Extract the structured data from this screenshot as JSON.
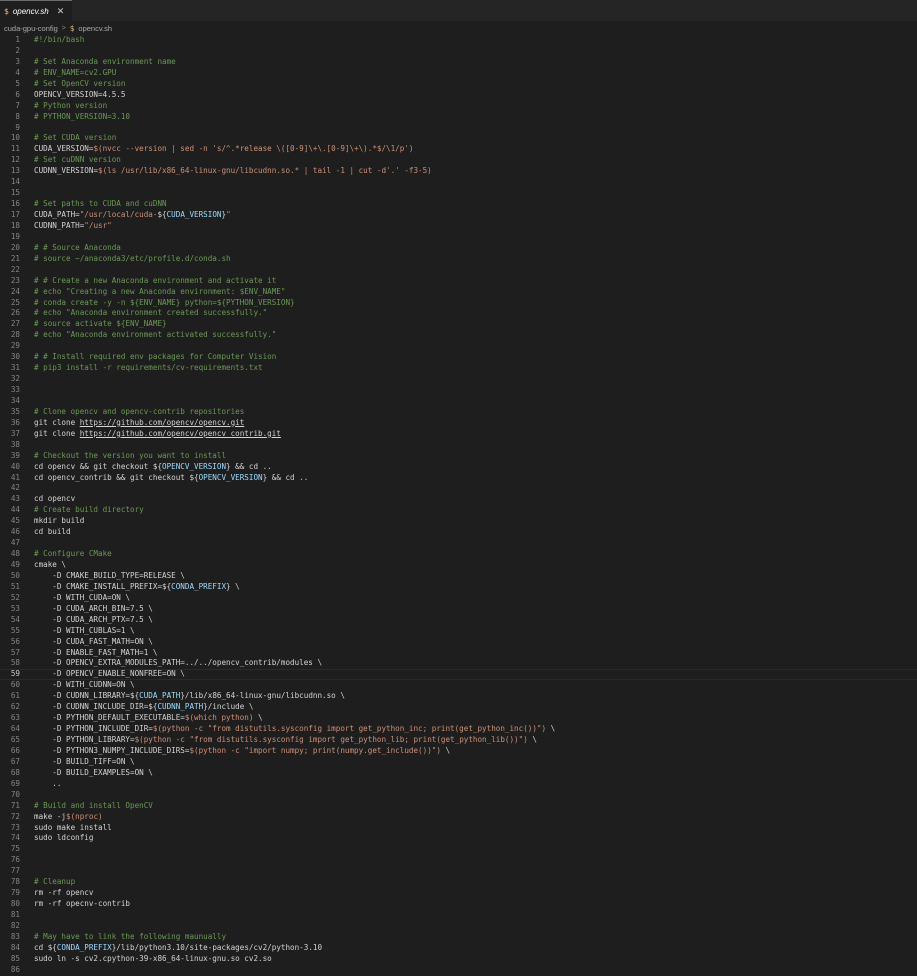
{
  "tab": {
    "icon": "$",
    "name": "opencv.sh",
    "close": "✕"
  },
  "breadcrumb": {
    "folder": "cuda-gpu-config",
    "separator": ">",
    "file_icon": "$",
    "file": "opencv.sh"
  },
  "editor": {
    "active_line": 59,
    "lines": [
      [
        [
          "c",
          "#!/bin/bash"
        ]
      ],
      [],
      [
        [
          "c",
          "# Set Anaconda environment name"
        ]
      ],
      [
        [
          "c",
          "# ENV_NAME=cv2.GPU"
        ]
      ],
      [
        [
          "c",
          "# Set OpenCV version"
        ]
      ],
      [
        [
          "t",
          "OPENCV_VERSION=4.5.5"
        ]
      ],
      [
        [
          "c",
          "# Python version"
        ]
      ],
      [
        [
          "c",
          "# PYTHON_VERSION=3.10"
        ]
      ],
      [],
      [
        [
          "c",
          "# Set CUDA version"
        ]
      ],
      [
        [
          "t",
          "CUDA_VERSION="
        ],
        [
          "s",
          "$(nvcc --version | sed -n 's/^.*release \\([0-9]\\+\\.[0-9]\\+\\).*$/\\1/p')"
        ]
      ],
      [
        [
          "c",
          "# Set cuDNN version"
        ]
      ],
      [
        [
          "t",
          "CUDNN_VERSION="
        ],
        [
          "s",
          "$(ls /usr/lib/x86_64-linux-gnu/libcudnn.so.* | tail -1 | cut -d'.' -f3-5)"
        ]
      ],
      [],
      [],
      [
        [
          "c",
          "# Set paths to CUDA and cuDNN"
        ]
      ],
      [
        [
          "t",
          "CUDA_PATH="
        ],
        [
          "s",
          "\"/usr/local/cuda-"
        ],
        [
          "t",
          "${"
        ],
        [
          "v",
          "CUDA_VERSION"
        ],
        [
          "t",
          "}"
        ],
        [
          "s",
          "\""
        ]
      ],
      [
        [
          "t",
          "CUDNN_PATH="
        ],
        [
          "s",
          "\"/usr\""
        ]
      ],
      [],
      [
        [
          "c",
          "# # Source Anaconda"
        ]
      ],
      [
        [
          "c",
          "# source ~/anaconda3/etc/profile.d/conda.sh"
        ]
      ],
      [],
      [
        [
          "c",
          "# # Create a new Anaconda environment and activate it"
        ]
      ],
      [
        [
          "c",
          "# echo \"Creating a new Anaconda environment: $ENV_NAME\""
        ]
      ],
      [
        [
          "c",
          "# conda create -y -n ${ENV_NAME} python=${PYTHON_VERSION}"
        ]
      ],
      [
        [
          "c",
          "# echo \"Anaconda environment created successfully.\""
        ]
      ],
      [
        [
          "c",
          "# source activate ${ENV_NAME}"
        ]
      ],
      [
        [
          "c",
          "# echo \"Anaconda environment activated successfully.\""
        ]
      ],
      [],
      [
        [
          "c",
          "# # Install required env packages for Computer Vision"
        ]
      ],
      [
        [
          "c",
          "# pip3 install -r requirements/cv-requirements.txt"
        ]
      ],
      [],
      [],
      [],
      [
        [
          "c",
          "# Clone opencv and opencv-contrib repositories"
        ]
      ],
      [
        [
          "t",
          "git clone "
        ],
        [
          "l",
          "https://github.com/opencv/opencv.git"
        ]
      ],
      [
        [
          "t",
          "git clone "
        ],
        [
          "l",
          "https://github.com/opencv/opencv_contrib.git"
        ]
      ],
      [],
      [
        [
          "c",
          "# Checkout the version you want to install"
        ]
      ],
      [
        [
          "t",
          "cd opencv && git checkout ${"
        ],
        [
          "v",
          "OPENCV_VERSION"
        ],
        [
          "t",
          "} && cd .."
        ]
      ],
      [
        [
          "t",
          "cd opencv_contrib && git checkout ${"
        ],
        [
          "v",
          "OPENCV_VERSION"
        ],
        [
          "t",
          "} && cd .."
        ]
      ],
      [],
      [
        [
          "t",
          "cd opencv"
        ]
      ],
      [
        [
          "c",
          "# Create build directory"
        ]
      ],
      [
        [
          "t",
          "mkdir build"
        ]
      ],
      [
        [
          "t",
          "cd build"
        ]
      ],
      [],
      [
        [
          "c",
          "# Configure CMake"
        ]
      ],
      [
        [
          "t",
          "cmake \\"
        ]
      ],
      [
        [
          "t",
          "    -D CMAKE_BUILD_TYPE=RELEASE \\"
        ]
      ],
      [
        [
          "t",
          "    -D CMAKE_INSTALL_PREFIX=${"
        ],
        [
          "v",
          "CONDA_PREFIX"
        ],
        [
          "t",
          "} \\"
        ]
      ],
      [
        [
          "t",
          "    -D WITH_CUDA=ON \\"
        ]
      ],
      [
        [
          "t",
          "    -D CUDA_ARCH_BIN=7.5 \\"
        ]
      ],
      [
        [
          "t",
          "    -D CUDA_ARCH_PTX=7.5 \\"
        ]
      ],
      [
        [
          "t",
          "    -D WITH_CUBLAS=1 \\"
        ]
      ],
      [
        [
          "t",
          "    -D CUDA_FAST_MATH=ON \\"
        ]
      ],
      [
        [
          "t",
          "    -D ENABLE_FAST_MATH=1 \\"
        ]
      ],
      [
        [
          "t",
          "    -D OPENCV_EXTRA_MODULES_PATH=../../opencv_contrib/modules \\"
        ]
      ],
      [
        [
          "t",
          "    -D OPENCV_ENABLE_NONFREE=ON \\"
        ]
      ],
      [
        [
          "t",
          "    -D WITH_CUDNN=ON \\"
        ]
      ],
      [
        [
          "t",
          "    -D CUDNN_LIBRARY=${"
        ],
        [
          "v",
          "CUDA_PATH"
        ],
        [
          "t",
          "}/lib/x86_64-linux-gnu/libcudnn.so \\"
        ]
      ],
      [
        [
          "t",
          "    -D CUDNN_INCLUDE_DIR=${"
        ],
        [
          "v",
          "CUDNN_PATH"
        ],
        [
          "t",
          "}/include \\"
        ]
      ],
      [
        [
          "t",
          "    -D PYTHON_DEFAULT_EXECUTABLE="
        ],
        [
          "s",
          "$(which python)"
        ],
        [
          "t",
          " \\"
        ]
      ],
      [
        [
          "t",
          "    -D PYTHON_INCLUDE_DIR="
        ],
        [
          "s",
          "$(python -c \"from distutils.sysconfig import get_python_inc; print(get_python_inc())\")"
        ],
        [
          "t",
          " \\"
        ]
      ],
      [
        [
          "t",
          "    -D PYTHON_LIBRARY="
        ],
        [
          "s",
          "$(python -c \"from distutils.sysconfig import get_python_lib; print(get_python_lib())\")"
        ],
        [
          "t",
          " \\"
        ]
      ],
      [
        [
          "t",
          "    -D PYTHON3_NUMPY_INCLUDE_DIRS="
        ],
        [
          "s",
          "$(python -c \"import numpy; print(numpy.get_include())\")"
        ],
        [
          "t",
          " \\"
        ]
      ],
      [
        [
          "t",
          "    -D BUILD_TIFF=ON \\"
        ]
      ],
      [
        [
          "t",
          "    -D BUILD_EXAMPLES=ON \\"
        ]
      ],
      [
        [
          "t",
          "    .."
        ]
      ],
      [],
      [
        [
          "c",
          "# Build and install OpenCV"
        ]
      ],
      [
        [
          "t",
          "make -j"
        ],
        [
          "s",
          "$(nproc)"
        ]
      ],
      [
        [
          "t",
          "sudo make install"
        ]
      ],
      [
        [
          "t",
          "sudo ldconfig"
        ]
      ],
      [],
      [],
      [],
      [
        [
          "c",
          "# Cleanup"
        ]
      ],
      [
        [
          "t",
          "rm -rf opencv"
        ]
      ],
      [
        [
          "t",
          "rm -rf opecnv-contrib"
        ]
      ],
      [],
      [],
      [
        [
          "c",
          "# May have to link the following maunually"
        ]
      ],
      [
        [
          "t",
          "cd ${"
        ],
        [
          "v",
          "CONDA_PREFIX"
        ],
        [
          "t",
          "}/lib/python3.10/site-packages/cv2/python-3.10"
        ]
      ],
      [
        [
          "t",
          "sudo ln -s cv2.cpython-39-x86_64-linux-gnu.so cv2.so"
        ]
      ],
      []
    ]
  },
  "colors": {
    "background": "#1e1e1e",
    "comment": "#6a9955",
    "string": "#ce9178",
    "variable": "#9cdcfe",
    "text": "#d4d4d4",
    "line_number": "#858585"
  }
}
